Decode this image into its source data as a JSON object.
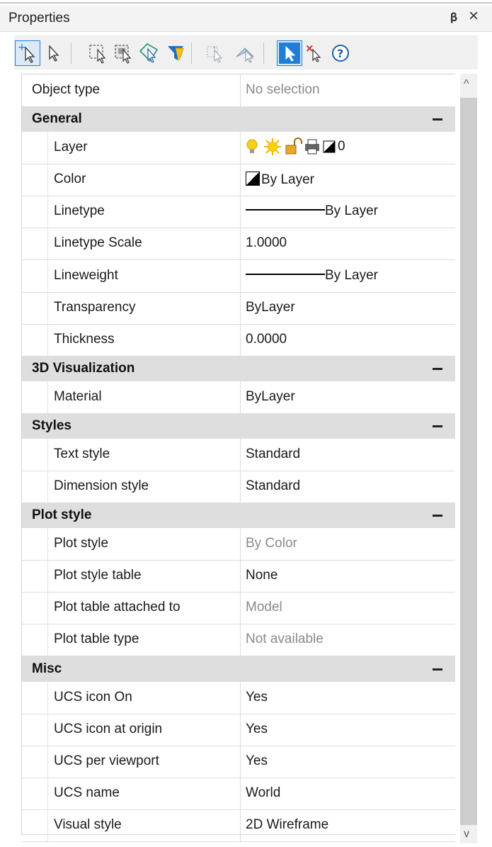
{
  "panel": {
    "title": "Properties",
    "pin_icon": "pin-icon",
    "close_icon": "close-icon"
  },
  "toolbar": {
    "buttons": [
      {
        "name": "toggle-pickadd-button",
        "icon": "pickadd-icon",
        "active": true
      },
      {
        "name": "select-objects-button",
        "icon": "cursor-icon"
      },
      {
        "name": "window-select-button",
        "icon": "window-select-icon"
      },
      {
        "name": "crossing-select-button",
        "icon": "crossing-select-icon"
      },
      {
        "name": "polygon-select-button",
        "icon": "polygon-select-icon"
      },
      {
        "name": "quick-select-button",
        "icon": "quick-select-filter-icon"
      },
      {
        "name": "select-similar-button",
        "icon": "select-similar-icon"
      },
      {
        "name": "pick-point-button",
        "icon": "pick-point-icon"
      },
      {
        "name": "select-mode-button",
        "icon": "select-arrow-icon",
        "active": true
      },
      {
        "name": "deselect-button",
        "icon": "deselect-icon"
      },
      {
        "name": "help-button",
        "icon": "help-icon"
      }
    ]
  },
  "object_type": {
    "label": "Object type",
    "value": "No selection"
  },
  "groups": [
    {
      "name": "General",
      "rows": [
        {
          "label": "Layer",
          "value": "0",
          "kind": "layer"
        },
        {
          "label": "Color",
          "value": "By Layer",
          "kind": "color"
        },
        {
          "label": "Linetype",
          "value": "By Layer",
          "kind": "line"
        },
        {
          "label": "Linetype Scale",
          "value": "1.0000"
        },
        {
          "label": "Lineweight",
          "value": "By Layer",
          "kind": "line"
        },
        {
          "label": "Transparency",
          "value": "ByLayer"
        },
        {
          "label": "Thickness",
          "value": "0.0000"
        }
      ]
    },
    {
      "name": "3D Visualization",
      "rows": [
        {
          "label": "Material",
          "value": "ByLayer"
        }
      ]
    },
    {
      "name": "Styles",
      "rows": [
        {
          "label": "Text style",
          "value": "Standard"
        },
        {
          "label": "Dimension style",
          "value": "Standard"
        }
      ]
    },
    {
      "name": "Plot style",
      "rows": [
        {
          "label": "Plot style",
          "value": "By Color",
          "gray": true
        },
        {
          "label": "Plot style table",
          "value": "None"
        },
        {
          "label": "Plot table attached to",
          "value": "Model",
          "gray": true
        },
        {
          "label": "Plot table type",
          "value": "Not available",
          "gray": true
        }
      ]
    },
    {
      "name": "Misc",
      "rows": [
        {
          "label": "UCS icon On",
          "value": "Yes"
        },
        {
          "label": "UCS icon at origin",
          "value": "Yes"
        },
        {
          "label": "UCS per viewport",
          "value": "Yes"
        },
        {
          "label": "UCS name",
          "value": "World"
        },
        {
          "label": "Visual style",
          "value": "2D Wireframe"
        }
      ]
    }
  ],
  "scrollbar": {
    "up_icon": "chevron-up-icon",
    "down_icon": "chevron-down-icon",
    "up_glyph": "^",
    "down_glyph": "v"
  },
  "colors": {
    "accent": "#1e7fd6",
    "category_bg": "#dedede",
    "grid_line": "#dcdcdc",
    "gray_text": "#8a8a8a"
  }
}
